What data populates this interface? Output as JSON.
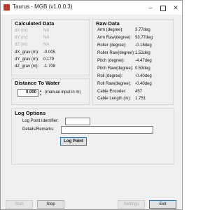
{
  "window": {
    "title": "Taurus - MGB (v1.0.0.3)"
  },
  "icons": {
    "app": "taurus-app-icon",
    "minimize": "minimize-icon",
    "maximize": "maximize-icon",
    "close": "close-icon",
    "spin_up": "spin-up-icon",
    "spin_down": "spin-down-icon"
  },
  "calculated": {
    "title": "Calculated Data",
    "rows": [
      {
        "label": "dX (m):",
        "value": "NA"
      },
      {
        "label": "dY (m):",
        "value": "NA"
      },
      {
        "label": "dZ (m):",
        "value": "NA"
      },
      {
        "label": "dX_grav (m):",
        "value": "-0.005"
      },
      {
        "label": "dY_grav (m):",
        "value": "0.179"
      },
      {
        "label": "dZ_grav (m):",
        "value": "-1.708"
      }
    ]
  },
  "raw": {
    "title": "Raw Data",
    "rows": [
      {
        "label": "Arm (degree):",
        "value": "3.77deg"
      },
      {
        "label": "Arm Raw(degree):",
        "value": "93.77deg"
      },
      {
        "label": "Roller (degree):",
        "value": "-0.18deg"
      },
      {
        "label": "Roller Raw(degree):",
        "value": "1.52deg"
      },
      {
        "label": "Pitch (degree):",
        "value": "-4.47deg"
      },
      {
        "label": "Pitch Raw(degree):",
        "value": "0.53deg"
      },
      {
        "label": "Roll (degree):",
        "value": "-0.40deg"
      },
      {
        "label": "Roll Raw(degree):",
        "value": "-0.40deg"
      },
      {
        "label": "Cable Encoder:",
        "value": "457"
      },
      {
        "label": "Cable Length (m):",
        "value": "1.751"
      }
    ]
  },
  "distance": {
    "title": "Distance To Water",
    "value": "0.000",
    "hint": "(manual input in m)"
  },
  "log": {
    "title": "Log Options",
    "identifier_label": "Log Point Identifier:",
    "identifier_value": "",
    "remarks_label": "Details/Remarks:",
    "remarks_value": "",
    "log_point_label": "Log Point"
  },
  "footer": {
    "start_label": "Start",
    "stop_label": "Stop",
    "settings_label": "Settings",
    "exit_label": "Exit"
  },
  "colors": {
    "accent": "#3a6fb0",
    "disabled_text": "#a8a8a8",
    "window_bg": "#f0f0f0"
  }
}
